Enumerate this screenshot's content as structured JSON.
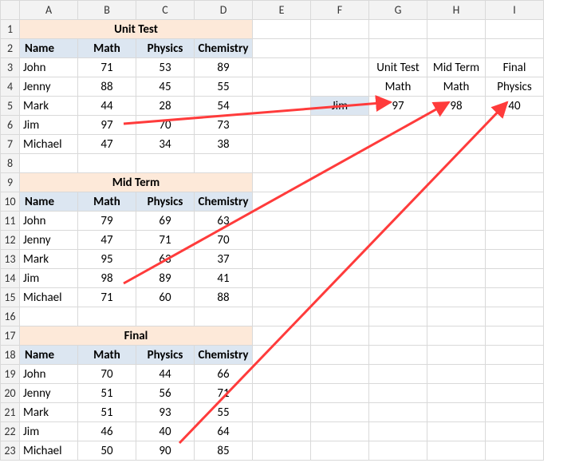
{
  "cols": [
    "A",
    "B",
    "C",
    "D",
    "E",
    "F",
    "G",
    "H",
    "I"
  ],
  "rows": [
    "1",
    "2",
    "3",
    "4",
    "5",
    "6",
    "7",
    "8",
    "9",
    "10",
    "11",
    "12",
    "13",
    "14",
    "15",
    "16",
    "17",
    "18",
    "19",
    "20",
    "21",
    "22",
    "23"
  ],
  "tables": {
    "unit": {
      "title": "Unit Test",
      "headers": [
        "Name",
        "Math",
        "Physics",
        "Chemistry"
      ],
      "rows": [
        {
          "name": "John",
          "math": "71",
          "physics": "53",
          "chemistry": "89"
        },
        {
          "name": "Jenny",
          "math": "88",
          "physics": "45",
          "chemistry": "55"
        },
        {
          "name": "Mark",
          "math": "44",
          "physics": "28",
          "chemistry": "54"
        },
        {
          "name": "Jim",
          "math": "97",
          "physics": "70",
          "chemistry": "73"
        },
        {
          "name": "Michael",
          "math": "47",
          "physics": "34",
          "chemistry": "38"
        }
      ]
    },
    "mid": {
      "title": "Mid Term",
      "headers": [
        "Name",
        "Math",
        "Physics",
        "Chemistry"
      ],
      "rows": [
        {
          "name": "John",
          "math": "79",
          "physics": "69",
          "chemistry": "63"
        },
        {
          "name": "Jenny",
          "math": "47",
          "physics": "71",
          "chemistry": "70"
        },
        {
          "name": "Mark",
          "math": "95",
          "physics": "63",
          "chemistry": "37"
        },
        {
          "name": "Jim",
          "math": "98",
          "physics": "89",
          "chemistry": "41"
        },
        {
          "name": "Michael",
          "math": "71",
          "physics": "60",
          "chemistry": "88"
        }
      ]
    },
    "final": {
      "title": "Final",
      "headers": [
        "Name",
        "Math",
        "Physics",
        "Chemistry"
      ],
      "rows": [
        {
          "name": "John",
          "math": "70",
          "physics": "44",
          "chemistry": "66"
        },
        {
          "name": "Jenny",
          "math": "51",
          "physics": "56",
          "chemistry": "71"
        },
        {
          "name": "Mark",
          "math": "51",
          "physics": "93",
          "chemistry": "55"
        },
        {
          "name": "Jim",
          "math": "46",
          "physics": "40",
          "chemistry": "64"
        },
        {
          "name": "Michael",
          "math": "50",
          "physics": "90",
          "chemistry": "85"
        }
      ]
    }
  },
  "lookup": {
    "headers1": [
      "Unit Test",
      "Mid Term",
      "Final"
    ],
    "headers2": [
      "Math",
      "Math",
      "Physics"
    ],
    "name": "Jim",
    "values": [
      "97",
      "98",
      "40"
    ]
  }
}
